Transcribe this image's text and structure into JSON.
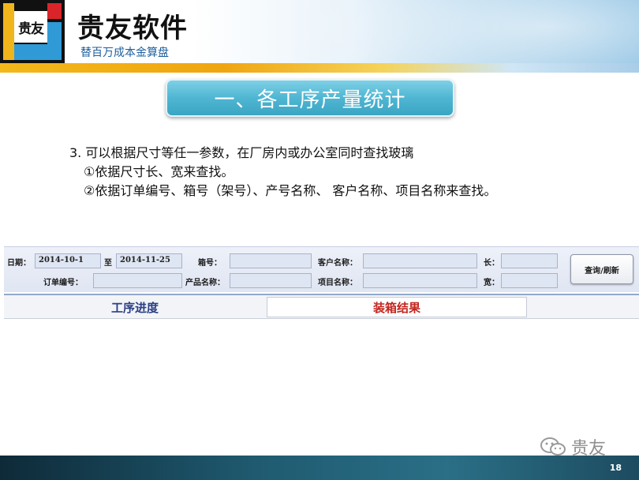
{
  "header": {
    "logo_text": "贵友",
    "title": "贵友软件",
    "subtitle": "替百万成本金算盘"
  },
  "section_title": "一、各工序产量统计",
  "bullets": {
    "line1": "3. 可以根据尺寸等任一参数，在厂房内或办公室同时查找玻璃",
    "line2": "①依据尺寸长、宽来查找。",
    "line3": "②依据订单编号、箱号（架号）、产号名称、 客户名称、项目名称来查找。"
  },
  "form": {
    "date_label": "日期：",
    "date_from": "2014-10-1",
    "to_label": "至",
    "date_to": "2014-11-25",
    "box_no_label": "箱号：",
    "box_no_value": "",
    "customer_label": "客户名称：",
    "customer_value": "",
    "length_label": "长：",
    "length_value": "",
    "order_no_label": "订单编号：",
    "order_no_value": "",
    "product_label": "产品名称：",
    "product_value": "",
    "project_label": "项目名称：",
    "project_value": "",
    "width_label": "宽：",
    "width_value": "",
    "query_button": "查询/刷新"
  },
  "tabs": {
    "process_progress": "工序进度",
    "packing_result": "装箱结果"
  },
  "watermark": "贵友",
  "page_number": "18",
  "colors": {
    "pill": "#4fb6d2",
    "brand_blue": "#2f9ad6",
    "brand_yellow": "#f1b51c",
    "brand_red": "#d9252a",
    "tab_blue_text": "#2a3f86",
    "tab_red_text": "#c3261f"
  }
}
